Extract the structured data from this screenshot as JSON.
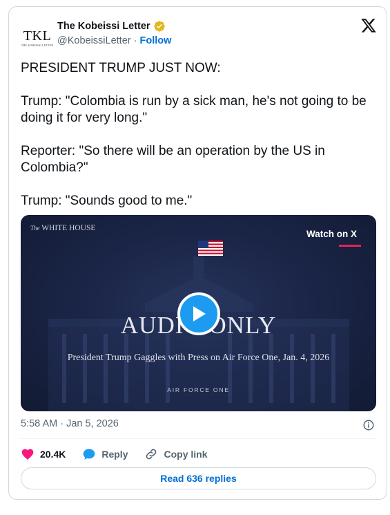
{
  "author": {
    "avatar_text": "TKL",
    "avatar_subtext": "THE KOBEISSI LETTER",
    "name": "The Kobeissi Letter",
    "handle": "@KobeissiLetter",
    "separator": "·",
    "follow_label": "Follow",
    "verified_icon": "verified-badge-gold",
    "verified_color": "#e2b719"
  },
  "platform_icon": "x-logo",
  "tweet": {
    "paragraphs": [
      "PRESIDENT TRUMP JUST NOW:",
      "Trump: \"Colombia is run by a sick man, he's not going to be doing it for very long.\"",
      "Reporter: \"So there will be an operation by the US in Colombia?\"",
      "Trump: \"Sounds good to me.\""
    ]
  },
  "media": {
    "corner_label_prefix": "The",
    "corner_label": "WHITE HOUSE",
    "watch_label": "Watch on X",
    "audio_text": "AUDIO ONLY",
    "title": "President Trump Gaggles with Press on Air Force One, Jan. 4, 2026",
    "subtitle": "AIR FORCE ONE",
    "play_icon": "play-icon",
    "accent": "#1d9bf0"
  },
  "meta": {
    "timestamp": "5:58 AM · Jan 5, 2026",
    "info_icon": "info-icon"
  },
  "actions": {
    "like_count": "20.4K",
    "like_color": "#f91880",
    "reply_label": "Reply",
    "copy_label": "Copy link"
  },
  "read_replies_label": "Read 636 replies",
  "colors": {
    "link": "#006fd6",
    "muted": "#536471",
    "text": "#0f1419",
    "border": "#cfd9de"
  }
}
